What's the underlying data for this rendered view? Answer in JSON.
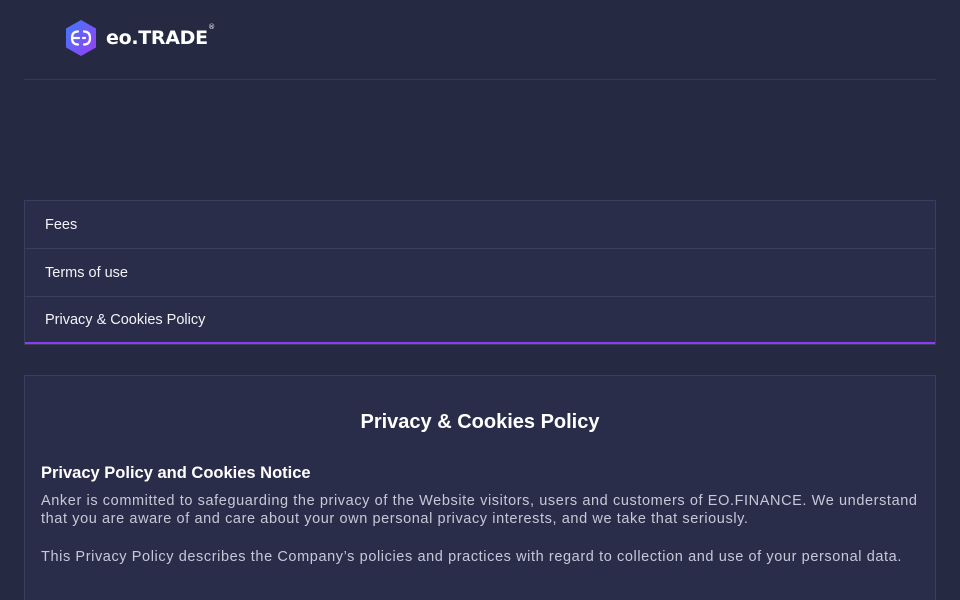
{
  "header": {
    "logo_text": "eo.TRADE",
    "logo_reg": "®"
  },
  "menu": {
    "items": [
      {
        "label": "Fees"
      },
      {
        "label": "Terms of use"
      },
      {
        "label": "Privacy & Cookies Policy",
        "active": true
      }
    ]
  },
  "content": {
    "title": "Privacy & Cookies Policy",
    "subtitle": "Privacy Policy and Cookies Notice",
    "paragraphs": [
      "Anker is committed to safeguarding the privacy of the Website visitors, users and customers of EO.FINANCE. We understand that you are aware of and care about your own personal privacy interests, and we take that seriously.",
      "This Privacy Policy describes the Company’s policies and practices with regard to collection and use of your personal data."
    ]
  },
  "colors": {
    "background": "#262942",
    "panel": "#2a2d49",
    "border": "#3b3f5e",
    "accent": "#8f3cf0",
    "logo_gradient_start": "#3d7bff",
    "logo_gradient_end": "#9b3cf0"
  },
  "icons": {
    "logo_mark": "eo-hexagon-logo-icon"
  }
}
